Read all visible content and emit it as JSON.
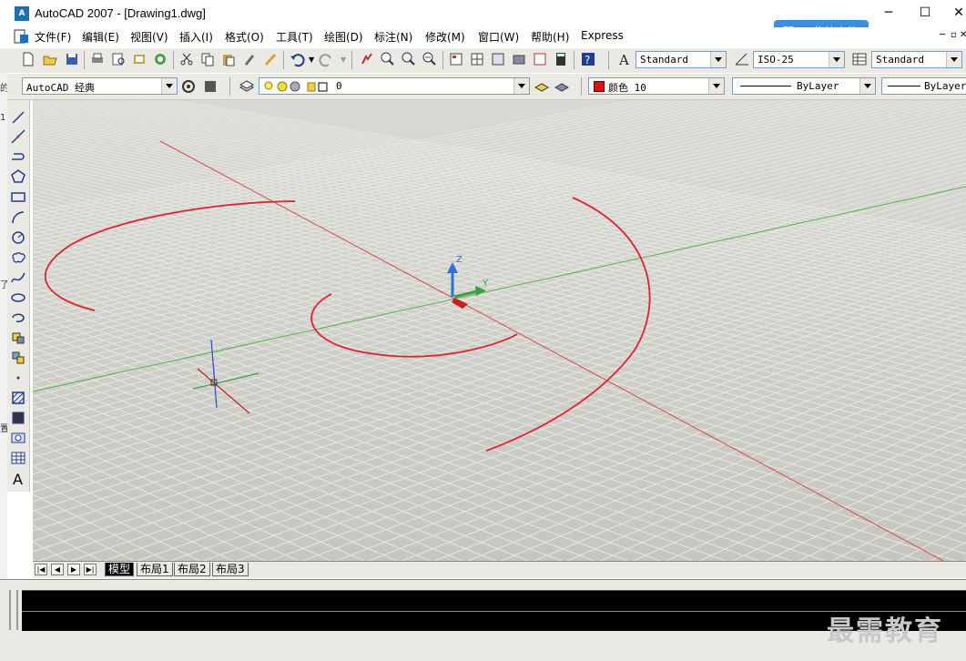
{
  "window": {
    "title": "AutoCAD 2007 - [Drawing1.dwg]",
    "app_icon_label": "A",
    "upload_badge": "拖拽上传",
    "controls": [
      "─",
      "☐",
      "✕"
    ]
  },
  "menu": {
    "items": [
      "文件(F)",
      "编辑(E)",
      "视图(V)",
      "插入(I)",
      "格式(O)",
      "工具(T)",
      "绘图(D)",
      "标注(N)",
      "修改(M)",
      "窗口(W)",
      "帮助(H)",
      "Express"
    ],
    "doc_controls": [
      "─",
      "▫",
      "✕"
    ]
  },
  "toolbar": {
    "text_style": "Standard",
    "dim_style": "ISO-25",
    "table_style": "Standard",
    "workspace": "AutoCAD 经典",
    "layer": "0",
    "color": "颜色 10",
    "linetype": "ByLayer",
    "lineweight": "ByLayer"
  },
  "viewport": {
    "ucs_labels": {
      "z": "Z",
      "y": "Y"
    },
    "colors": {
      "grid": "#e6e6e2",
      "background": "#cfcfca",
      "arcs": "#e0202a",
      "x_axis": "#d84a4a",
      "y_axis": "#55b04a",
      "z_axis": "#2f6fd6"
    }
  },
  "layout_tabs": {
    "nav": [
      "|◀",
      "◀",
      "▶",
      "▶|"
    ],
    "tabs": [
      "模型",
      "布局1",
      "布局2",
      "布局3"
    ],
    "active_index": 0
  },
  "edge_text": [
    "的",
    "",
    "",
    "",
    "1",
    "",
    "",
    "了",
    "",
    "",
    "",
    "",
    "",
    "置"
  ],
  "watermark": "最需教育"
}
